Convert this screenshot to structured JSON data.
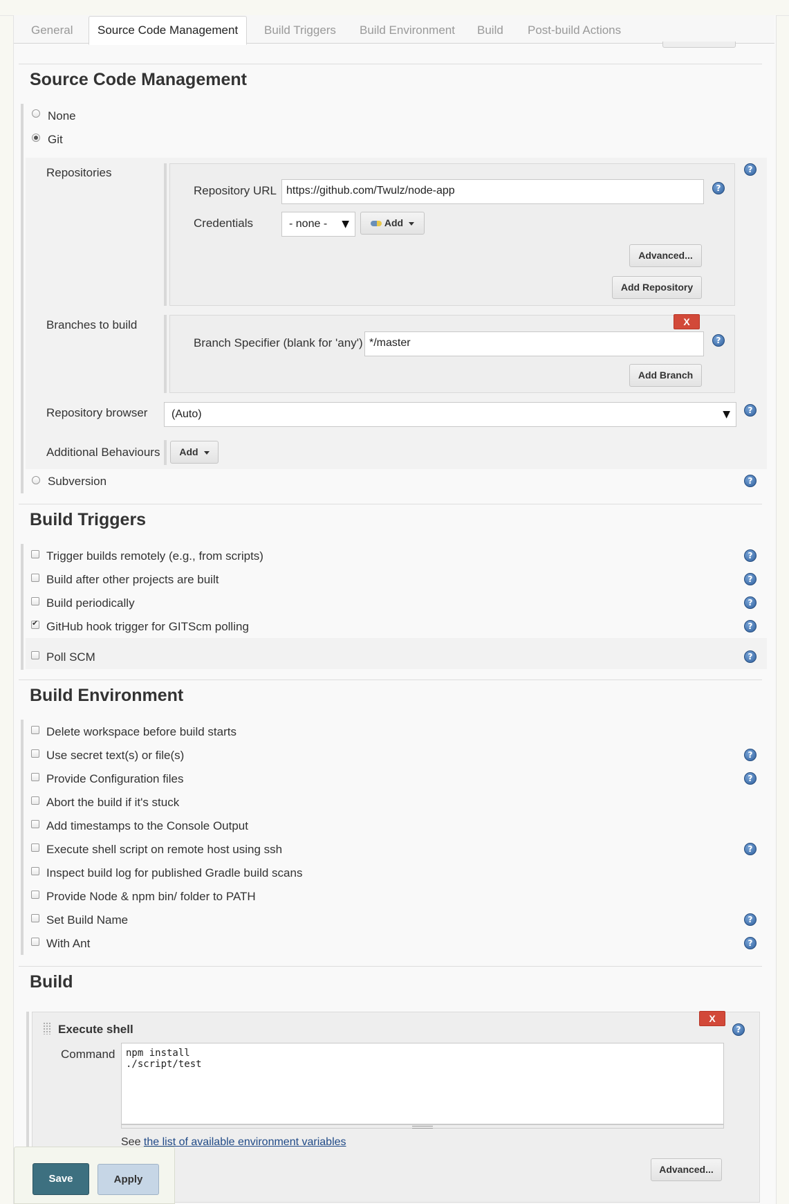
{
  "tabs": [
    "General",
    "Source Code Management",
    "Build Triggers",
    "Build Environment",
    "Build",
    "Post-build Actions"
  ],
  "scm": {
    "title": "Source Code Management",
    "options": {
      "none": "None",
      "git": "Git",
      "subversion": "Subversion"
    },
    "repositories_label": "Repositories",
    "repo_url_label": "Repository URL",
    "repo_url_value": "https://github.com/Twulz/node-app",
    "credentials_label": "Credentials",
    "credentials_value": "- none -",
    "add_label": "Add",
    "advanced_label": "Advanced...",
    "add_repository_label": "Add Repository",
    "branches_label": "Branches to build",
    "branch_specifier_label": "Branch Specifier (blank for 'any')",
    "branch_value": "*/master",
    "delete_label": "X",
    "add_branch_label": "Add Branch",
    "repo_browser_label": "Repository browser",
    "repo_browser_value": "(Auto)",
    "additional_behaviours_label": "Additional Behaviours",
    "additional_add_label": "Add"
  },
  "build_triggers": {
    "title": "Build Triggers",
    "items": [
      {
        "label": "Trigger builds remotely (e.g., from scripts)",
        "checked": false
      },
      {
        "label": "Build after other projects are built",
        "checked": false
      },
      {
        "label": "Build periodically",
        "checked": false
      },
      {
        "label": "GitHub hook trigger for GITScm polling",
        "checked": true
      },
      {
        "label": "Poll SCM",
        "checked": false
      }
    ]
  },
  "build_environment": {
    "title": "Build Environment",
    "items": [
      {
        "label": "Delete workspace before build starts",
        "checked": false
      },
      {
        "label": "Use secret text(s) or file(s)",
        "checked": false
      },
      {
        "label": "Provide Configuration files",
        "checked": false
      },
      {
        "label": "Abort the build if it's stuck",
        "checked": false
      },
      {
        "label": "Add timestamps to the Console Output",
        "checked": false
      },
      {
        "label": "Execute shell script on remote host using ssh",
        "checked": false
      },
      {
        "label": "Inspect build log for published Gradle build scans",
        "checked": false
      },
      {
        "label": "Provide Node & npm bin/ folder to PATH",
        "checked": false
      },
      {
        "label": "Set Build Name",
        "checked": false
      },
      {
        "label": "With Ant",
        "checked": false
      }
    ]
  },
  "build": {
    "title": "Build",
    "step_title": "Execute shell",
    "command_label": "Command",
    "command_value": "npm install\n./script/test",
    "see_prefix": "See ",
    "env_link": "the list of available environment variables",
    "advanced_label": "Advanced...",
    "delete_label": "X"
  },
  "footer": {
    "save_label": "Save",
    "apply_label": "Apply"
  },
  "help_glyph": "?",
  "colors": {
    "save": "#3d7080",
    "apply": "#c6d6e6",
    "delete": "#d24939",
    "help": "#2f5f9c"
  }
}
